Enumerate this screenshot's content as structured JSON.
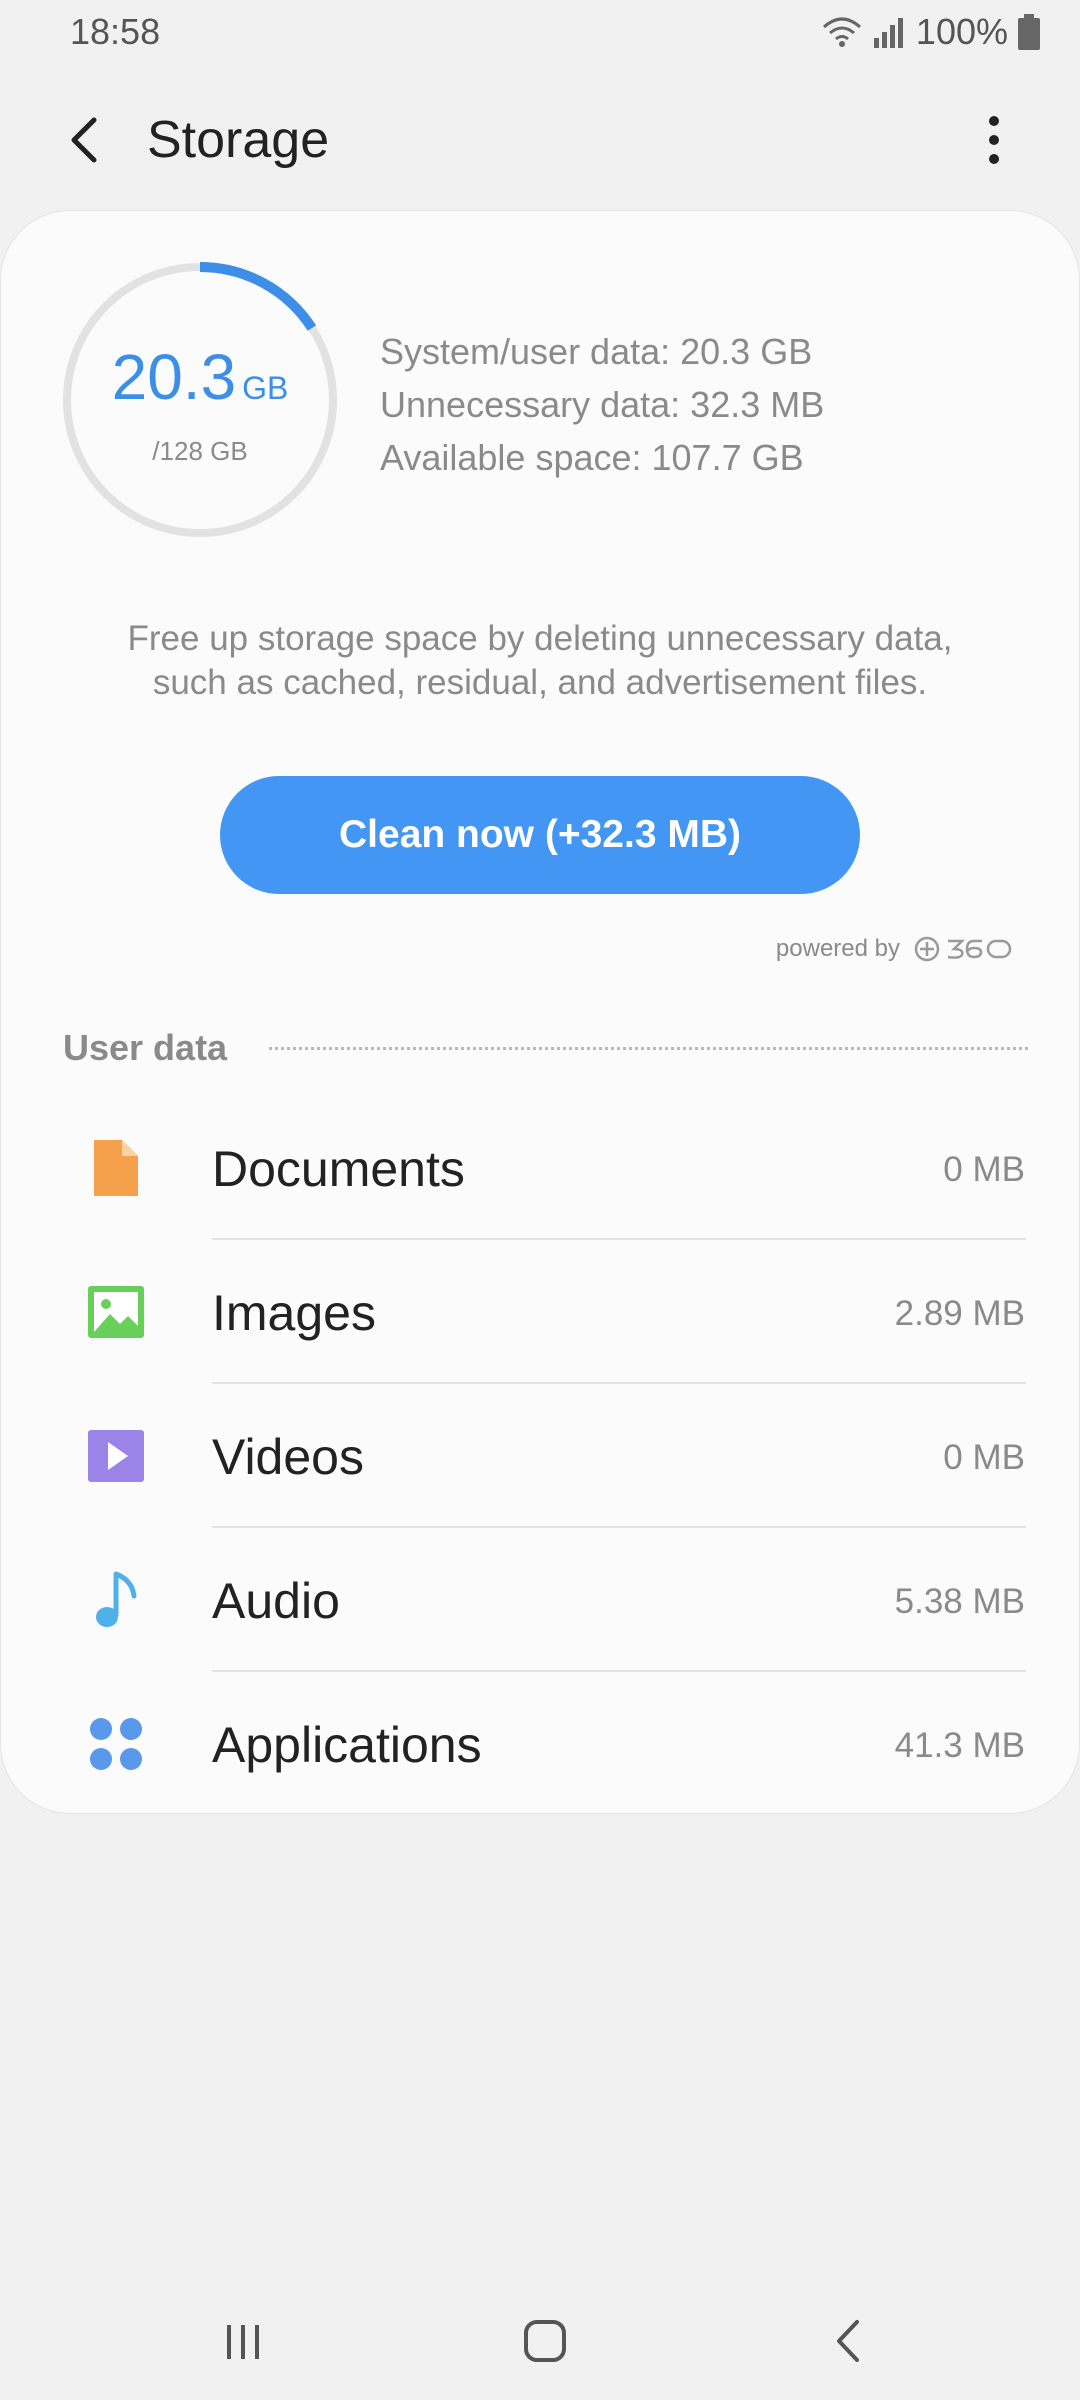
{
  "status_bar": {
    "time": "18:58",
    "battery": "100%",
    "icons": [
      "wifi-icon",
      "signal-icon",
      "battery-icon"
    ]
  },
  "app_bar": {
    "title": "Storage",
    "back_icon": "back-arrow-icon",
    "more_icon": "more-vert-icon"
  },
  "summary": {
    "used_value": "20.3",
    "used_unit": "GB",
    "total": "/128 GB",
    "used_fraction": 0.159,
    "stats": [
      "System/user data: 20.3 GB",
      "Unnecessary data: 32.3 MB",
      "Available space: 107.7 GB"
    ],
    "description_line1": "Free up storage space by deleting unnecessary data,",
    "description_line2": "such as cached, residual, and advertisement files.",
    "clean_button": "Clean now (+32.3 MB)",
    "powered_by": "powered by"
  },
  "user_data": {
    "title": "User data",
    "items": [
      {
        "label": "Documents",
        "size": "0 MB",
        "icon": "document-icon",
        "color": "#f5a04a"
      },
      {
        "label": "Images",
        "size": "2.89 MB",
        "icon": "image-icon",
        "color": "#68d05a"
      },
      {
        "label": "Videos",
        "size": "0 MB",
        "icon": "video-icon",
        "color": "#9b83e8"
      },
      {
        "label": "Audio",
        "size": "5.38 MB",
        "icon": "music-note-icon",
        "color": "#4fb0ea"
      },
      {
        "label": "Applications",
        "size": "41.3 MB",
        "icon": "apps-icon",
        "color": "#5a98eb"
      }
    ]
  },
  "colors": {
    "accent": "#4396f4",
    "ring_track": "#e2e2e2",
    "ring_fill": "#3d8ee6"
  },
  "nav_bar": {
    "icons": [
      "recents-icon",
      "home-icon",
      "back-icon"
    ]
  }
}
